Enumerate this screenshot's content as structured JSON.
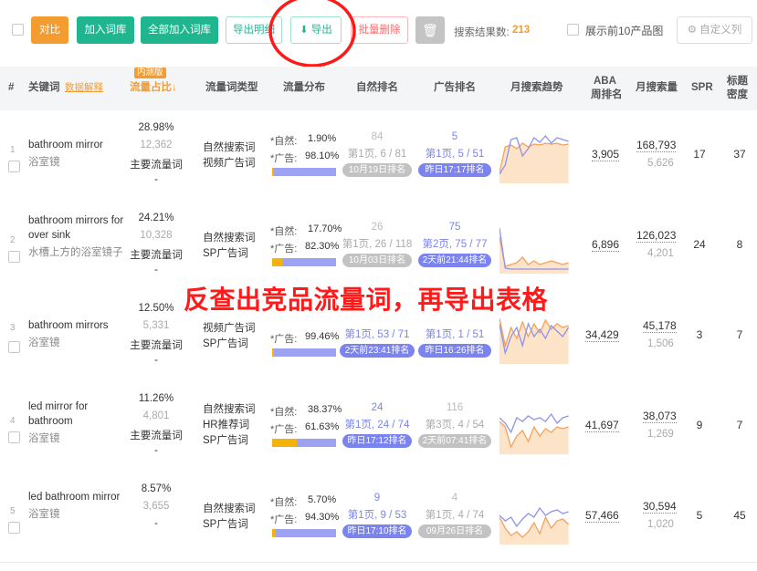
{
  "toolbar": {
    "compare": "对比",
    "add_to_lib": "加入词库",
    "add_all": "全部加入词库",
    "export_detail": "导出明细",
    "export": "导出",
    "batch_delete": "批量删除",
    "result_label": "搜索结果数:",
    "result_count": "213",
    "show_top": "展示前10产品图",
    "custom_col": "自定义列"
  },
  "header": {
    "index": "#",
    "keyword": "关键词",
    "keyword_link": "数据解释",
    "beta": "内测版",
    "share": "流量占比↓",
    "type": "流量词类型",
    "dist": "流量分布",
    "organic": "自然排名",
    "ad": "广告排名",
    "trend": "月搜索趋势",
    "aba1": "ABA",
    "aba2": "周排名",
    "volume": "月搜索量",
    "spr": "SPR",
    "density1": "标题",
    "density2": "密度"
  },
  "rows": [
    {
      "num": "1",
      "kw": "bathroom mirror",
      "cn": "浴室镜",
      "pct": "28.98%",
      "count": "12,362",
      "main": "主要流量词",
      "dash": "-",
      "types": [
        "自然搜索词",
        "视频广告词"
      ],
      "nat": "*自然:",
      "natv": "1.90%",
      "adl": "*广告:",
      "adv": "98.10%",
      "nat_share": 0.019,
      "org_top": "84",
      "org_mid": "第1页, 6 / 81",
      "org_pill": "10月19日排名",
      "ad_top": "5",
      "ad_mid": "第1页, 5 / 51",
      "ad_pill": "昨日17:17排名",
      "aba": "3,905",
      "vol": "168,793",
      "vol2": "5,626",
      "spr": "17",
      "den": "37"
    },
    {
      "num": "2",
      "kw": "bathroom mirrors for over sink",
      "cn": "水槽上方的浴室镜子",
      "pct": "24.21%",
      "count": "10,328",
      "main": "主要流量词",
      "dash": "-",
      "types": [
        "自然搜索词",
        "SP广告词"
      ],
      "nat": "*自然:",
      "natv": "17.70%",
      "adl": "*广告:",
      "adv": "82.30%",
      "nat_share": 0.177,
      "org_top": "26",
      "org_mid": "第1页, 26 / 118",
      "org_pill": "10月03日排名",
      "ad_top": "75",
      "ad_mid": "第2页, 75 / 77",
      "ad_pill": "2天前21:44排名",
      "aba": "6,896",
      "vol": "126,023",
      "vol2": "4,201",
      "spr": "24",
      "den": "8"
    },
    {
      "num": "3",
      "kw": "bathroom mirrors",
      "cn": "浴室镜",
      "pct": "12.50%",
      "count": "5,331",
      "main": "主要流量词",
      "dash": "-",
      "types": [
        "视频广告词",
        "SP广告词"
      ],
      "nat": "",
      "natv": "",
      "adl": "*广告:",
      "adv": "99.46%",
      "nat_share": 0.005,
      "org_top": "",
      "org_mid": "第1页, 53 / 71",
      "org_pill": "2天前23:41排名",
      "ad_top": "",
      "ad_mid": "第1页, 1 / 51",
      "ad_pill": "昨日16:26排名",
      "aba": "34,429",
      "vol": "45,178",
      "vol2": "1,506",
      "spr": "3",
      "den": "7"
    },
    {
      "num": "4",
      "kw": "led mirror for bathroom",
      "cn": "浴室镜",
      "pct": "11.26%",
      "count": "4,801",
      "main": "主要流量词",
      "dash": "-",
      "types": [
        "自然搜索词",
        "HR推荐词",
        "SP广告词"
      ],
      "nat": "*自然:",
      "natv": "38.37%",
      "adl": "*广告:",
      "adv": "61.63%",
      "nat_share": 0.3837,
      "org_top": "24",
      "org_mid": "第1页, 24 / 74",
      "org_pill": "昨日17:12排名",
      "ad_top": "116",
      "ad_mid": "第3页, 4 / 54",
      "ad_pill": "2天前07:41排名",
      "aba": "41,697",
      "vol": "38,073",
      "vol2": "1,269",
      "spr": "9",
      "den": "7"
    },
    {
      "num": "5",
      "kw": "led bathroom mirror",
      "cn": "浴室镜",
      "pct": "8.57%",
      "count": "3,655",
      "main": "",
      "dash": "-",
      "types": [
        "自然搜索词",
        "SP广告词"
      ],
      "nat": "*自然:",
      "natv": "5.70%",
      "adl": "*广告:",
      "adv": "94.30%",
      "nat_share": 0.057,
      "org_top": "9",
      "org_mid": "第1页, 9 / 53",
      "org_pill": "昨日17:10排名",
      "ad_top": "4",
      "ad_mid": "第1页, 4 / 74",
      "ad_pill": "09月26日排名",
      "aba": "57,466",
      "vol": "30,594",
      "vol2": "1,020",
      "spr": "5",
      "den": "45"
    }
  ],
  "annotation": "反查出竞品流量词，再导出表格",
  "colors": {
    "green": "#1fb68f",
    "orange": "#f39c30",
    "red": "#ff1a1a",
    "blue": "#7b83ee",
    "amber": "#f4b30c"
  }
}
